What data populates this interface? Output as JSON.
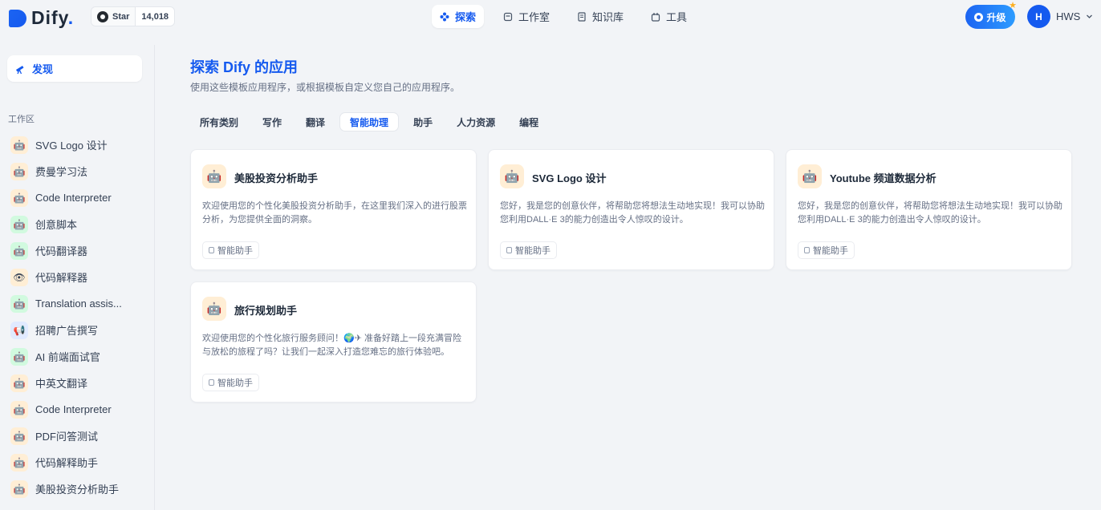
{
  "header": {
    "logo_text": "Dify",
    "logo_accent": ".",
    "github": {
      "star_label": "Star",
      "star_count": "14,018"
    },
    "nav": [
      {
        "label": "探索",
        "icon": "compass-icon",
        "active": true
      },
      {
        "label": "工作室",
        "icon": "studio-icon",
        "active": false
      },
      {
        "label": "知识库",
        "icon": "book-icon",
        "active": false
      },
      {
        "label": "工具",
        "icon": "tools-icon",
        "active": false
      }
    ],
    "upgrade_label": "升级",
    "user": {
      "avatar_initial": "H",
      "name": "HWS"
    }
  },
  "sidebar": {
    "discover_label": "发现",
    "section_label": "工作区",
    "apps": [
      {
        "label": "SVG Logo 设计",
        "icon": "🤖",
        "bg": "#ffeed5"
      },
      {
        "label": "费曼学习法",
        "icon": "🤖",
        "bg": "#ffeed5"
      },
      {
        "label": "Code Interpreter",
        "icon": "🤖",
        "bg": "#ffeed5"
      },
      {
        "label": "创意脚本",
        "icon": "🤖",
        "bg": "#d1fadf"
      },
      {
        "label": "代码翻译器",
        "icon": "🤖",
        "bg": "#d1fadf"
      },
      {
        "label": "代码解释器",
        "icon": "👁",
        "bg": "#ffeed5"
      },
      {
        "label": "Translation assis...",
        "icon": "🤖",
        "bg": "#d1fadf"
      },
      {
        "label": "招聘广告撰写",
        "icon": "📢",
        "bg": "#e0eaff"
      },
      {
        "label": "AI 前端面试官",
        "icon": "🤖",
        "bg": "#d1fadf"
      },
      {
        "label": "中英文翻译",
        "icon": "🤖",
        "bg": "#ffeed5"
      },
      {
        "label": "Code Interpreter",
        "icon": "🤖",
        "bg": "#ffeed5"
      },
      {
        "label": "PDF问答测试",
        "icon": "🤖",
        "bg": "#ffeed5"
      },
      {
        "label": "代码解释助手",
        "icon": "🤖",
        "bg": "#ffeed5"
      },
      {
        "label": "美股投资分析助手",
        "icon": "🤖",
        "bg": "#ffeed5"
      }
    ]
  },
  "main": {
    "title": "探索 Dify 的应用",
    "subtitle": "使用这些模板应用程序，或根据模板自定义您自己的应用程序。",
    "categories": [
      {
        "label": "所有类别",
        "active": false
      },
      {
        "label": "写作",
        "active": false
      },
      {
        "label": "翻译",
        "active": false
      },
      {
        "label": "智能助理",
        "active": true
      },
      {
        "label": "助手",
        "active": false
      },
      {
        "label": "人力资源",
        "active": false
      },
      {
        "label": "编程",
        "active": false
      }
    ],
    "cards": [
      {
        "title": "美股投资分析助手",
        "desc": "欢迎使用您的个性化美股投资分析助手，在这里我们深入的进行股票分析，为您提供全面的洞察。",
        "tag": "智能助手",
        "icon": "🤖"
      },
      {
        "title": "SVG Logo 设计",
        "desc": "您好，我是您的创意伙伴，将帮助您将想法生动地实现！我可以协助您利用DALL·E 3的能力创造出令人惊叹的设计。",
        "tag": "智能助手",
        "icon": "🤖"
      },
      {
        "title": "Youtube 频道数据分析",
        "desc": "您好，我是您的创意伙伴，将帮助您将想法生动地实现！我可以协助您利用DALL·E 3的能力创造出令人惊叹的设计。",
        "tag": "智能助手",
        "icon": "🤖"
      },
      {
        "title": "旅行规划助手",
        "desc": "欢迎使用您的个性化旅行服务顾问！🌍✈ 准备好踏上一段充满冒险与放松的旅程了吗？让我们一起深入打造您难忘的旅行体验吧。",
        "tag": "智能助手",
        "icon": "🤖"
      }
    ]
  },
  "colors": {
    "accent": "#155aef",
    "background": "#f2f4f7"
  }
}
